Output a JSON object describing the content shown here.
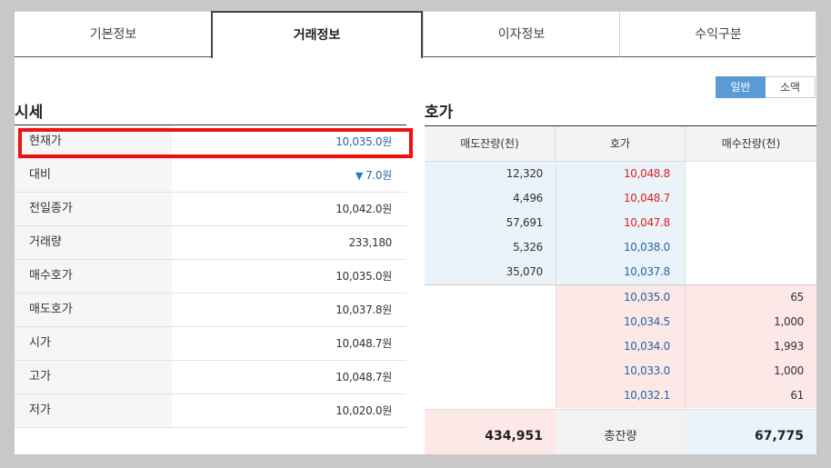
{
  "tabs": [
    {
      "label": "기본정보",
      "active": false
    },
    {
      "label": "거래정보",
      "active": true
    },
    {
      "label": "이자정보",
      "active": false
    },
    {
      "label": "수익구분",
      "active": false
    }
  ],
  "toggle": {
    "normal": "일반",
    "small": "소액",
    "selected": "일반"
  },
  "quote": {
    "title": "시세",
    "rows": [
      {
        "label": "현재가",
        "value": "10,035.0원"
      },
      {
        "label": "대비",
        "change_icon": "down-triangle-icon",
        "value": "7.0원"
      },
      {
        "label": "전일종가",
        "value": "10,042.0원"
      },
      {
        "label": "거래량",
        "value": "233,180"
      },
      {
        "label": "매수호가",
        "value": "10,035.0원"
      },
      {
        "label": "매도호가",
        "value": "10,037.8원"
      },
      {
        "label": "시가",
        "value": "10,048.7원"
      },
      {
        "label": "고가",
        "value": "10,048.7원"
      },
      {
        "label": "저가",
        "value": "10,020.0원"
      }
    ]
  },
  "orderbook": {
    "title": "호가",
    "headers": {
      "sell_qty": "매도잔량(천)",
      "price": "호가",
      "buy_qty": "매수잔량(천)"
    },
    "sell": [
      {
        "qty": "12,320",
        "price": "10,048.8"
      },
      {
        "qty": "4,496",
        "price": "10,048.7"
      },
      {
        "qty": "57,691",
        "price": "10,047.8"
      },
      {
        "qty": "5,326",
        "price": "10,038.0"
      },
      {
        "qty": "35,070",
        "price": "10,037.8"
      }
    ],
    "buy": [
      {
        "price": "10,035.0",
        "qty": "65"
      },
      {
        "price": "10,034.5",
        "qty": "1,000"
      },
      {
        "price": "10,034.0",
        "qty": "1,993"
      },
      {
        "price": "10,033.0",
        "qty": "1,000"
      },
      {
        "price": "10,032.1",
        "qty": "61"
      }
    ],
    "total": {
      "sell": "434,951",
      "label": "총잔량",
      "buy": "67,775"
    }
  },
  "colors": {
    "highlight": "#ee1111",
    "accent": "#5a9bd5",
    "ask_price": "#dd2222",
    "bid_price": "#2a63a6"
  }
}
